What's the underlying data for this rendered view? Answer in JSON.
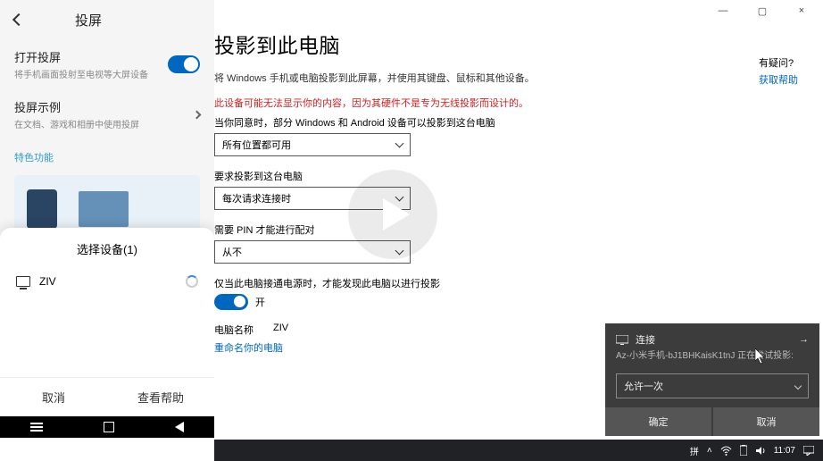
{
  "phone": {
    "title": "投屏",
    "row1": {
      "title": "打开投屏",
      "sub": "将手机画面投射至电视等大屏设备"
    },
    "row2": {
      "title": "投屏示例",
      "sub": "在文档、游戏和相册中使用投屏"
    },
    "section_label": "特色功能",
    "sheet": {
      "title": "选择设备(1)",
      "device": "ZIV",
      "cancel": "取消",
      "help": "查看帮助"
    }
  },
  "win": {
    "page_title": "投影到此电脑",
    "desc": "将 Windows 手机或电脑投影到此屏幕，并使用其键盘、鼠标和其他设备。",
    "warn": "此设备可能无法显示你的内容，因为其硬件不是专为无线投影而设计的。",
    "opt_in_label": "当你同意时，部分 Windows 和 Android 设备可以投影到这台电脑",
    "sel1": "所有位置都可用",
    "ask_label": "要求投影到这台电脑",
    "sel2": "每次请求连接时",
    "pin_label": "需要 PIN 才能进行配对",
    "sel3": "从不",
    "power_label": "仅当此电脑接通电源时，才能发现此电脑以进行投影",
    "toggle_on": "开",
    "pcname_label": "电脑名称",
    "pcname_value": "ZIV",
    "rename_link": "重命名你的电脑",
    "help_title": "有疑问?",
    "help_link": "获取帮助",
    "titlebar": {
      "min": "—",
      "max": "▢",
      "close": "×"
    }
  },
  "toast": {
    "title": "连接",
    "device_line": "Az-小米手机-bJ1BHKaisK1tnJ 正在尝试投影:",
    "select": "允许一次",
    "ok": "确定",
    "cancel": "取消"
  },
  "taskbar": {
    "ime": "拼",
    "time": "11:07"
  }
}
